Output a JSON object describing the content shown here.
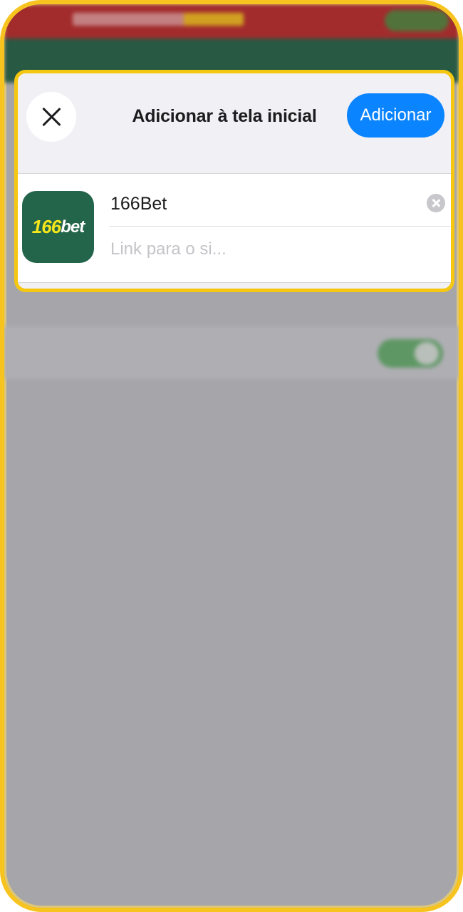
{
  "sheet": {
    "title": "Adicionar à tela inicial",
    "close_icon": "close-icon",
    "add_label": "Adicionar",
    "accent_color": "#0a84ff",
    "highlight_color": "#f6c711"
  },
  "form": {
    "app_icon": {
      "number": "166",
      "word": "bet",
      "background": "#23654a"
    },
    "name_value": "166Bet",
    "clear_icon": "clear-circle-icon",
    "link_placeholder": "Link para o si..."
  }
}
